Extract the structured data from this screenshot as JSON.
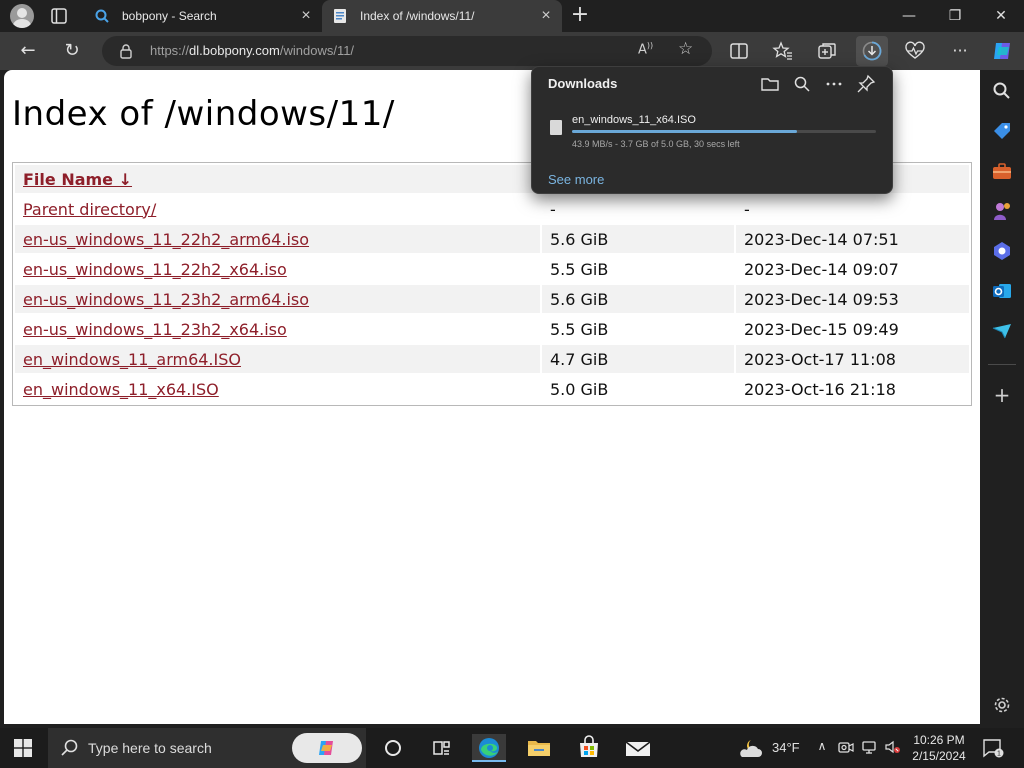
{
  "browser": {
    "tabs": [
      {
        "title": "bobpony - Search",
        "active": false
      },
      {
        "title": "Index of /windows/11/",
        "active": true
      }
    ],
    "address": {
      "prefix": "https://",
      "host": "dl.bobpony.com",
      "path": "/windows/11/"
    }
  },
  "page": {
    "heading": "Index of /windows/11/",
    "table": {
      "headers": [
        "File Name  ↓",
        "",
        ""
      ],
      "parent": {
        "name": "Parent directory/",
        "size": "-",
        "date": "-"
      },
      "rows": [
        {
          "name": "en-us_windows_11_22h2_arm64.iso",
          "size": "5.6 GiB",
          "date": "2023-Dec-14 07:51"
        },
        {
          "name": "en-us_windows_11_22h2_x64.iso",
          "size": "5.5 GiB",
          "date": "2023-Dec-14 09:07"
        },
        {
          "name": "en-us_windows_11_23h2_arm64.iso",
          "size": "5.6 GiB",
          "date": "2023-Dec-14 09:53"
        },
        {
          "name": "en-us_windows_11_23h2_x64.iso",
          "size": "5.5 GiB",
          "date": "2023-Dec-15 09:49"
        },
        {
          "name": "en_windows_11_arm64.ISO",
          "size": "4.7 GiB",
          "date": "2023-Oct-17 11:08"
        },
        {
          "name": "en_windows_11_x64.ISO",
          "size": "5.0 GiB",
          "date": "2023-Oct-16 21:18"
        }
      ]
    }
  },
  "downloads": {
    "title": "Downloads",
    "item": {
      "filename": "en_windows_11_x64.ISO",
      "status": "43.9 MB/s - 3.7 GB of 5.0 GB, 30 secs left",
      "progress": 0.74
    },
    "see_more": "See more"
  },
  "taskbar": {
    "search_placeholder": "Type here to search",
    "temperature": "34°F",
    "time": "10:26 PM",
    "date": "2/15/2024"
  },
  "colors": {
    "link": "#8e1f2a",
    "progress": "#6aa8d8",
    "see_more": "#7ab4e0"
  }
}
